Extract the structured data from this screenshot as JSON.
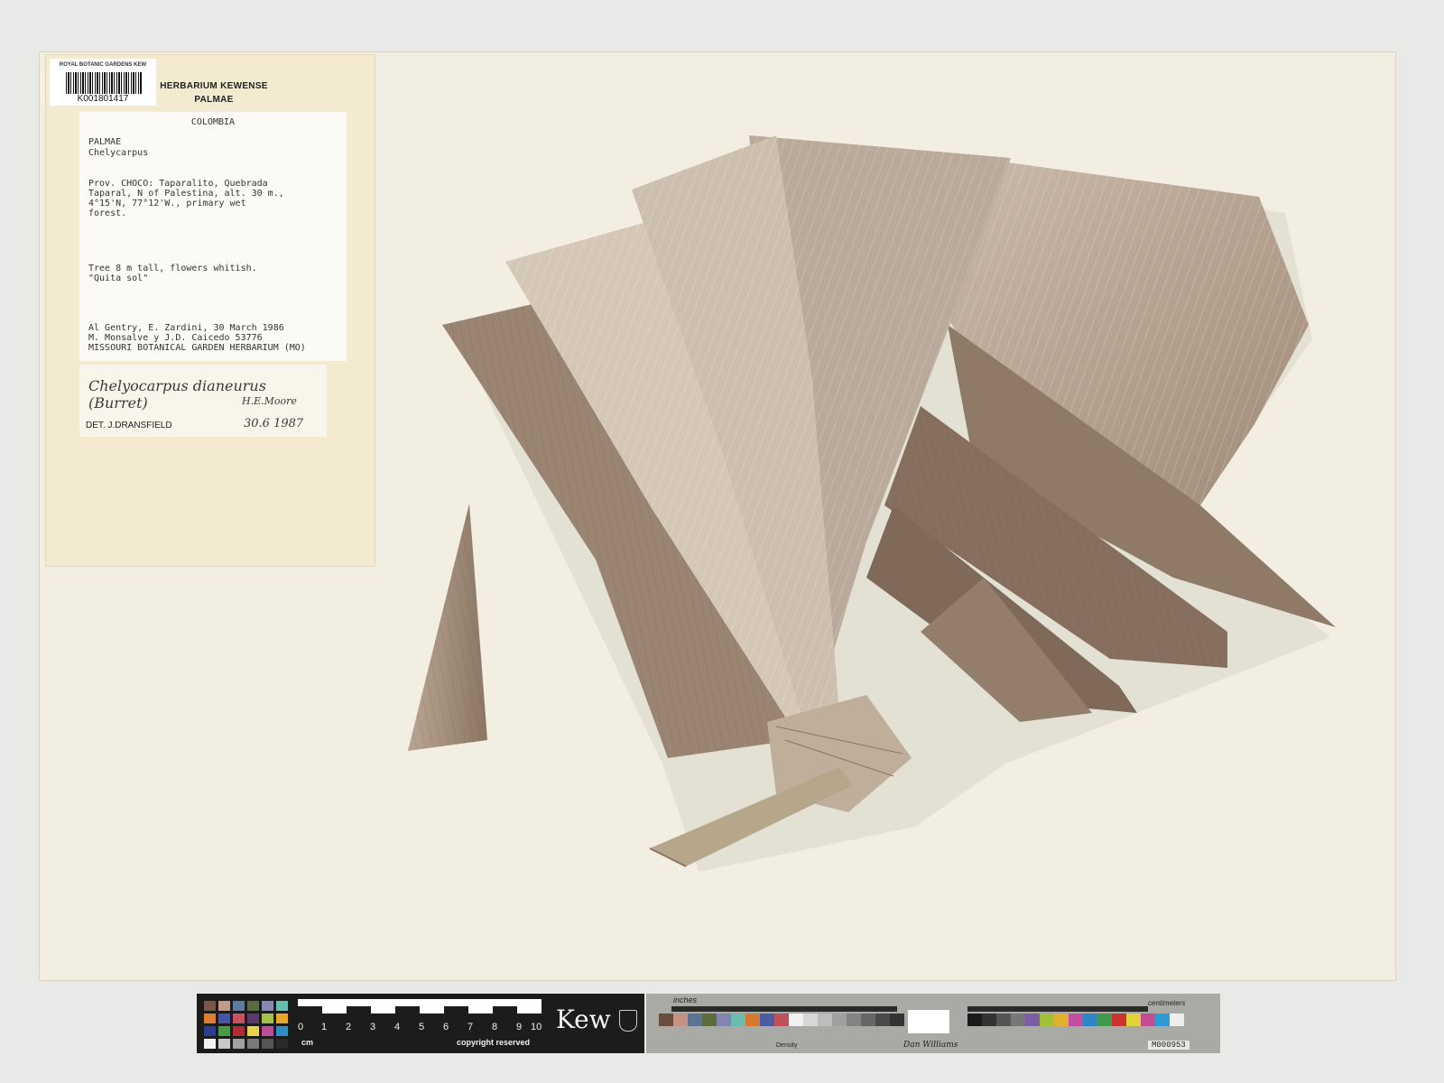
{
  "institution_label": "ROYAL BOTANIC GARDENS KEW",
  "barcode": "K001801417",
  "herbarium": "HERBARIUM KEWENSE",
  "herbarium_family": "PALMAE",
  "collection_label": {
    "country": "COLOMBIA",
    "family": "PALMAE",
    "genus": "Chelycarpus",
    "locality": "Prov. CHOCO:  Taparalito, Quebrada\nTaparal, N of Palestina, alt. 30 m.,\n4°15'N, 77°12'W., primary wet\nforest.",
    "notes": "Tree 8 m tall, flowers whitish.\n\"Quita sol\"",
    "collectors": "Al Gentry, E. Zardini, 30 March 1986\nM. Monsalve y J.D. Caicedo    53776\nMISSOURI BOTANICAL GARDEN HERBARIUM (MO)"
  },
  "determination": {
    "name": "Chelyocarpus dianeurus (Burret)",
    "author": "H.E.Moore",
    "by": "DET.  J.DRANSFIELD",
    "date": "30.6 1987"
  },
  "scale_bar": {
    "numbers": [
      "0",
      "1",
      "2",
      "3",
      "4",
      "5",
      "6",
      "7",
      "8",
      "9",
      "10"
    ],
    "unit": "cm",
    "copyright": "copyright reserved",
    "logo": "Kew"
  },
  "color_target": {
    "inches_label": "inches",
    "cm_label": "centimeters",
    "density_label": "Density",
    "signature": "Dan Williams",
    "code": "M000953"
  },
  "colors": {
    "sheet": "#f2eee2",
    "folder": "#f3ead0",
    "leaf_light": "#c9b8a6",
    "leaf_dark": "#8f7a68"
  }
}
